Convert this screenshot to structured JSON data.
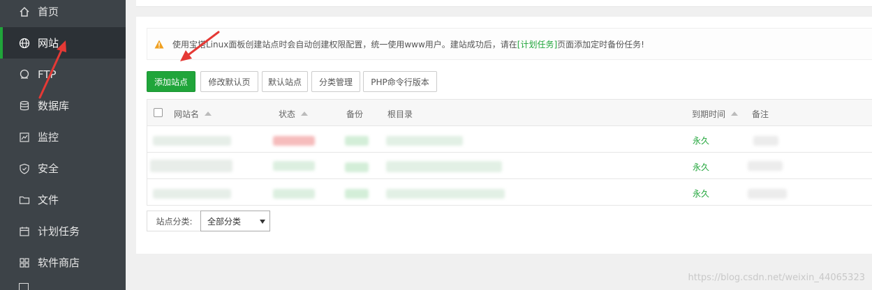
{
  "sidebar": {
    "items": [
      {
        "label": "首页",
        "icon": "home-icon"
      },
      {
        "label": "网站",
        "icon": "globe-icon",
        "active": true
      },
      {
        "label": "FTP",
        "icon": "ftp-icon"
      },
      {
        "label": "数据库",
        "icon": "database-icon"
      },
      {
        "label": "监控",
        "icon": "monitor-icon"
      },
      {
        "label": "安全",
        "icon": "shield-icon"
      },
      {
        "label": "文件",
        "icon": "folder-icon"
      },
      {
        "label": "计划任务",
        "icon": "calendar-icon"
      },
      {
        "label": "软件商店",
        "icon": "grid-icon"
      }
    ]
  },
  "alert": {
    "text_before": "使用宝塔Linux面板创建站点时会自动创建权限配置，统一使用www用户。建站成功后，请在",
    "link": "[计划任务]",
    "text_after": "页面添加定时备份任务!"
  },
  "toolbar": {
    "add_site": "添加站点",
    "edit_default_page": "修改默认页",
    "default_site": "默认站点",
    "category_manage": "分类管理",
    "php_cli_version": "PHP命令行版本"
  },
  "table": {
    "headers": {
      "site_name": "网站名",
      "status": "状态",
      "backup": "备份",
      "root_dir": "根目录",
      "expire": "到期时间",
      "remark": "备注"
    },
    "rows": [
      {
        "expire": "永久"
      },
      {
        "expire": "永久"
      },
      {
        "expire": "永久"
      }
    ]
  },
  "category": {
    "label": "站点分类:",
    "selected": "全部分类"
  },
  "watermark": "https://blog.csdn.net/weixin_44065323",
  "colors": {
    "sidebar_bg": "#3d4348",
    "accent": "#20a53a",
    "annotation_arrow": "#e53935"
  }
}
